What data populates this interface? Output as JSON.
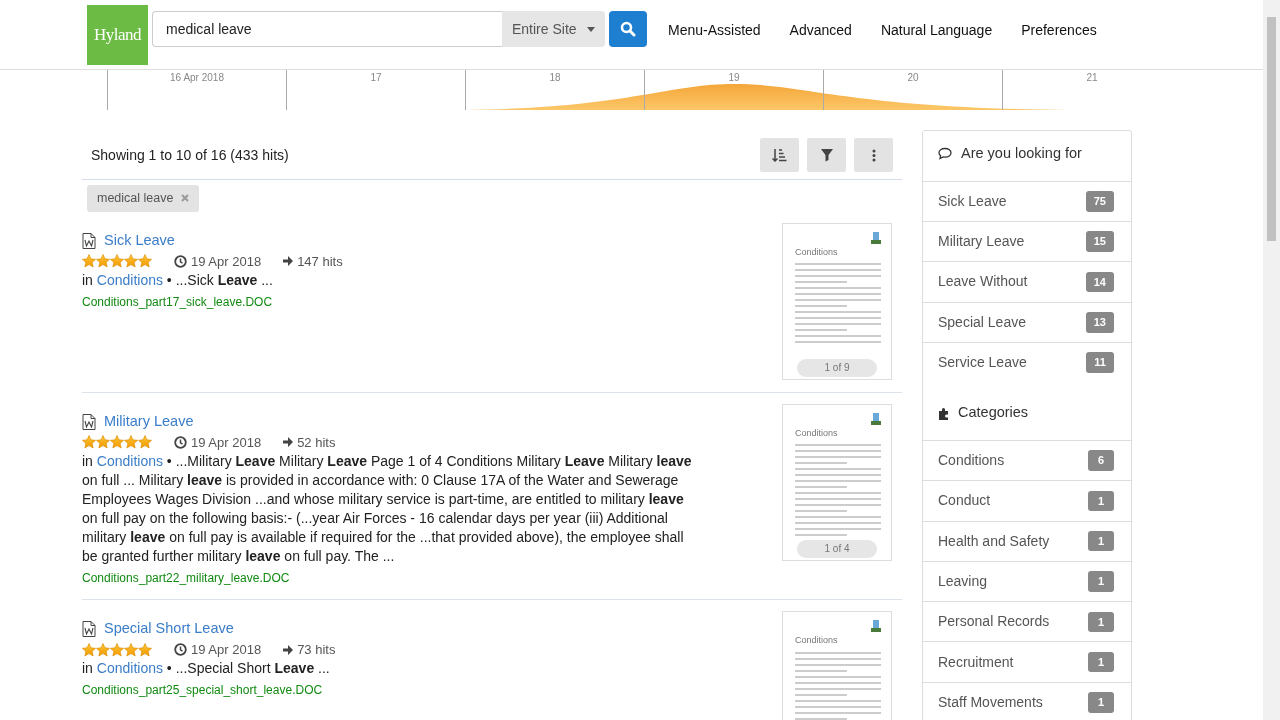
{
  "header": {
    "logo": "Hyland",
    "search": {
      "value": "medical leave"
    },
    "scope": "Entire Site",
    "nav": [
      {
        "label": "Menu-Assisted"
      },
      {
        "label": "Advanced"
      },
      {
        "label": "Natural Language"
      },
      {
        "label": "Preferences"
      }
    ]
  },
  "timeline": {
    "labels": [
      "16 Apr 2018",
      "17",
      "18",
      "19",
      "20",
      "21"
    ]
  },
  "results_summary": "Showing 1 to 10 of 16 (433 hits)",
  "filters": [
    {
      "label": "medical leave"
    }
  ],
  "results": [
    {
      "title": "Sick Leave",
      "stars": 5,
      "date": "19 Apr 2018",
      "hits": "147 hits",
      "in_label": "in",
      "category": "Conditions",
      "snippet": "• ...Sick **Leave** ...",
      "filename": "Conditions_part17_sick_leave.DOC",
      "preview": {
        "title": "Conditions",
        "page_label": "1 of 9"
      }
    },
    {
      "title": "Military Leave",
      "stars": 5,
      "date": "19 Apr 2018",
      "hits": "52 hits",
      "in_label": "in",
      "category": "Conditions",
      "snippet": "• ...Military **Leave** Military **Leave** Page 1 of 4 Conditions Military **Leave** Military **leave** on full ... Military **leave** is provided in accordance with: 0 Clause 17A of the Water and Sewerage Employees Wages Division ...and whose military service is part-time, are entitled to military **leave** on full pay on the following basis:- (...year Air Forces - 16 calendar days per year (iii) Additional military **leave** on full pay is available if required for the ...that provided above), the employee shall be granted further military **leave** on full pay. The ...",
      "filename": "Conditions_part22_military_leave.DOC",
      "preview": {
        "title": "Conditions",
        "page_label": "1 of 4"
      }
    },
    {
      "title": "Special Short Leave",
      "stars": 5,
      "date": "19 Apr 2018",
      "hits": "73 hits",
      "in_label": "in",
      "category": "Conditions",
      "snippet": "• ...Special Short **Leave** ...",
      "filename": "Conditions_part25_special_short_leave.DOC",
      "preview": {
        "title": "Conditions"
      }
    }
  ],
  "suggestions": {
    "title": "Are you looking for",
    "items": [
      {
        "label": "Sick Leave",
        "count": "75"
      },
      {
        "label": "Military Leave",
        "count": "15"
      },
      {
        "label": "Leave Without",
        "count": "14"
      },
      {
        "label": "Special Leave",
        "count": "13"
      },
      {
        "label": "Service Leave",
        "count": "11"
      }
    ]
  },
  "categories": {
    "title": "Categories",
    "items": [
      {
        "label": "Conditions",
        "count": "6"
      },
      {
        "label": "Conduct",
        "count": "1"
      },
      {
        "label": "Health and Safety",
        "count": "1"
      },
      {
        "label": "Leaving",
        "count": "1"
      },
      {
        "label": "Personal Records",
        "count": "1"
      },
      {
        "label": "Recruitment",
        "count": "1"
      },
      {
        "label": "Staff Movements",
        "count": "1"
      }
    ]
  }
}
